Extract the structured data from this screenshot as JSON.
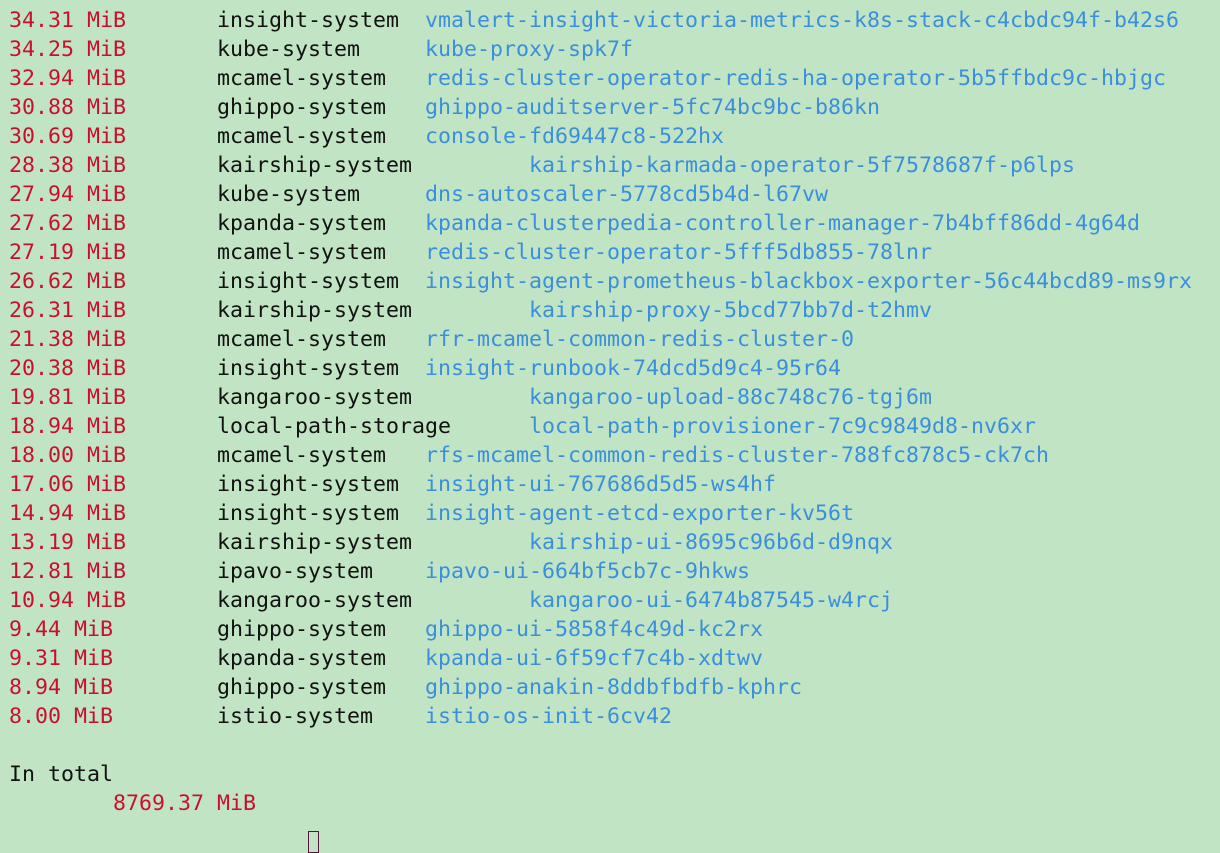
{
  "colors": {
    "background": "#c1e5c4",
    "memory": "#c8102e",
    "namespace": "#111111",
    "pod": "#3a8fdc"
  },
  "rows": [
    {
      "mem": "34.31 MiB",
      "ns": "insight-system",
      "pod": "vmalert-insight-victoria-metrics-k8s-stack-c4cbdc94f-b42s6"
    },
    {
      "mem": "34.25 MiB",
      "ns": "kube-system",
      "pod": "kube-proxy-spk7f"
    },
    {
      "mem": "32.94 MiB",
      "ns": "mcamel-system",
      "pod": "redis-cluster-operator-redis-ha-operator-5b5ffbdc9c-hbjgc"
    },
    {
      "mem": "30.88 MiB",
      "ns": "ghippo-system",
      "pod": "ghippo-auditserver-5fc74bc9bc-b86kn"
    },
    {
      "mem": "30.69 MiB",
      "ns": "mcamel-system",
      "pod": "console-fd69447c8-522hx"
    },
    {
      "mem": "28.38 MiB",
      "ns": "kairship-system",
      "pod": "kairship-karmada-operator-5f7578687f-p6lps"
    },
    {
      "mem": "27.94 MiB",
      "ns": "kube-system",
      "pod": "dns-autoscaler-5778cd5b4d-l67vw"
    },
    {
      "mem": "27.62 MiB",
      "ns": "kpanda-system",
      "pod": "kpanda-clusterpedia-controller-manager-7b4bff86dd-4g64d"
    },
    {
      "mem": "27.19 MiB",
      "ns": "mcamel-system",
      "pod": "redis-cluster-operator-5fff5db855-78lnr"
    },
    {
      "mem": "26.62 MiB",
      "ns": "insight-system",
      "pod": "insight-agent-prometheus-blackbox-exporter-56c44bcd89-ms9rx"
    },
    {
      "mem": "26.31 MiB",
      "ns": "kairship-system",
      "pod": "kairship-proxy-5bcd77bb7d-t2hmv"
    },
    {
      "mem": "21.38 MiB",
      "ns": "mcamel-system",
      "pod": "rfr-mcamel-common-redis-cluster-0"
    },
    {
      "mem": "20.38 MiB",
      "ns": "insight-system",
      "pod": "insight-runbook-74dcd5d9c4-95r64"
    },
    {
      "mem": "19.81 MiB",
      "ns": "kangaroo-system",
      "pod": "kangaroo-upload-88c748c76-tgj6m"
    },
    {
      "mem": "18.94 MiB",
      "ns": "local-path-storage",
      "pod": "local-path-provisioner-7c9c9849d8-nv6xr"
    },
    {
      "mem": "18.00 MiB",
      "ns": "mcamel-system",
      "pod": "rfs-mcamel-common-redis-cluster-788fc878c5-ck7ch"
    },
    {
      "mem": "17.06 MiB",
      "ns": "insight-system",
      "pod": "insight-ui-767686d5d5-ws4hf"
    },
    {
      "mem": "14.94 MiB",
      "ns": "insight-system",
      "pod": "insight-agent-etcd-exporter-kv56t"
    },
    {
      "mem": "13.19 MiB",
      "ns": "kairship-system",
      "pod": "kairship-ui-8695c96b6d-d9nqx"
    },
    {
      "mem": "12.81 MiB",
      "ns": "ipavo-system",
      "pod": "ipavo-ui-664bf5cb7c-9hkws"
    },
    {
      "mem": "10.94 MiB",
      "ns": "kangaroo-system",
      "pod": "kangaroo-ui-6474b87545-w4rcj"
    },
    {
      "mem": "9.44 MiB",
      "ns": "ghippo-system",
      "pod": "ghippo-ui-5858f4c49d-kc2rx"
    },
    {
      "mem": "9.31 MiB",
      "ns": "kpanda-system",
      "pod": "kpanda-ui-6f59cf7c4b-xdtwv"
    },
    {
      "mem": "8.94 MiB",
      "ns": "ghippo-system",
      "pod": "ghippo-anakin-8ddbfbdfb-kphrc"
    },
    {
      "mem": "8.00 MiB",
      "ns": "istio-system",
      "pod": "istio-os-init-6cv42"
    }
  ],
  "summary": {
    "label": "In total",
    "value": "8769.37 MiB"
  }
}
